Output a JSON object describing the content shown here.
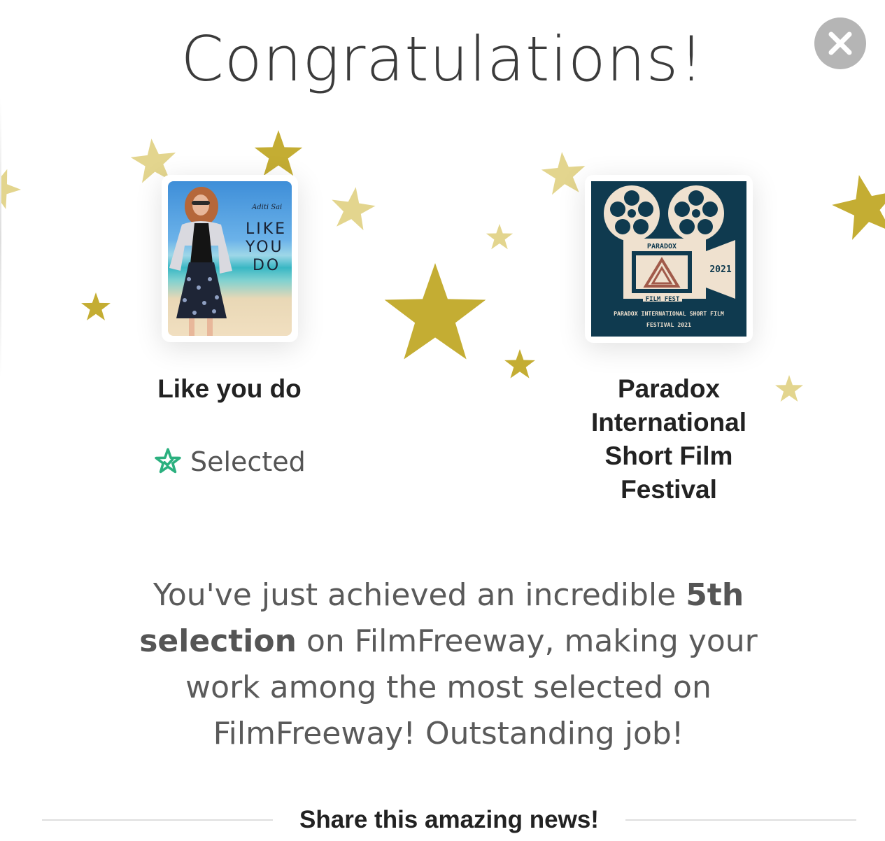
{
  "dialog": {
    "title": "Congratulations!",
    "close_icon": "close-icon"
  },
  "project": {
    "title": "Like you do",
    "poster_text": "LIKE\nYOU\n DO",
    "poster_signature": "Aditi Sai",
    "status_icon": "selected-star-icon",
    "status_label": "Selected",
    "status_color": "#2bb07f"
  },
  "festival": {
    "name": "Paradox International Short Film Festival",
    "logo": {
      "top_label": "PARADOX",
      "year": "2021",
      "bottom_label": "FILM FEST",
      "caption_line1": "PARADOX INTERNATIONAL SHORT FILM",
      "caption_line2": "FESTIVAL 2021"
    }
  },
  "message": {
    "prefix": "You've just achieved an incredible ",
    "highlight": "5th selection",
    "suffix": " on FilmFreeway, making your work among the most selected on FilmFreeway! Outstanding job!"
  },
  "share": {
    "label": "Share this amazing news!"
  },
  "colors": {
    "star_gold": "#c4ad33",
    "star_light": "#e3d58e",
    "logo_navy": "#0f3a4f",
    "logo_cream": "#efe1cf"
  }
}
